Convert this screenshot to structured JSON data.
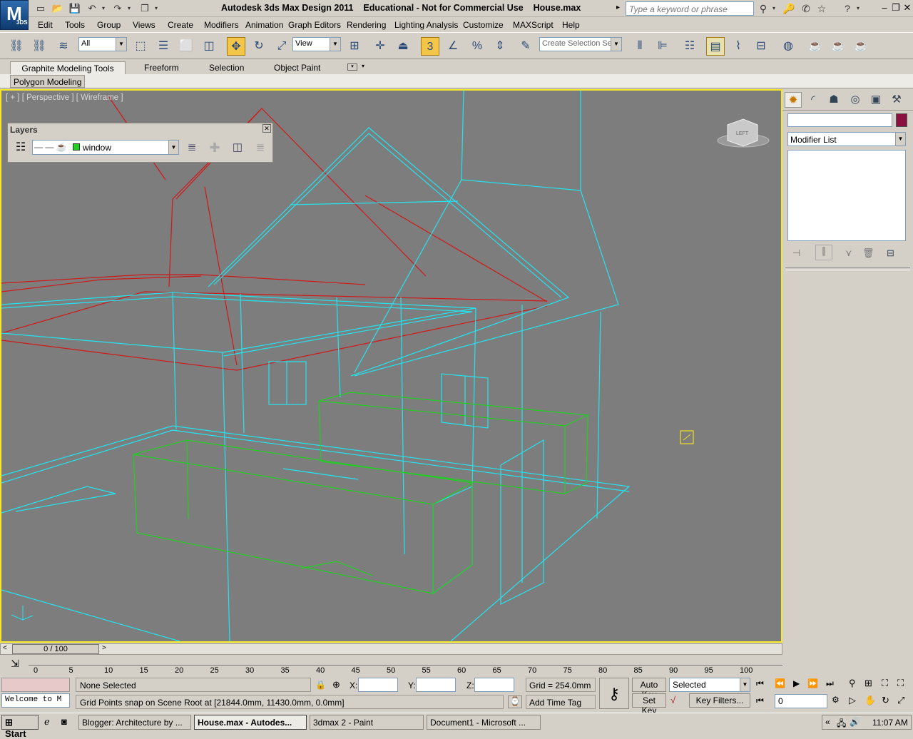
{
  "titlebar": {
    "logo": "3DS",
    "title": "Autodesk 3ds Max Design 2011    Educational - Not for Commercial Use    House.max",
    "search_placeholder": "Type a keyword or phrase"
  },
  "menu": [
    "Edit",
    "Tools",
    "Group",
    "Views",
    "Create",
    "Modifiers",
    "Animation",
    "Graph Editors",
    "Rendering",
    "Lighting Analysis",
    "Customize",
    "MAXScript",
    "Help"
  ],
  "toolbar": {
    "filter_value": "All",
    "coord_value": "View",
    "snap_label": "3",
    "selection_set_placeholder": "Create Selection Se"
  },
  "ribbon": {
    "tabs": [
      "Graphite Modeling Tools",
      "Freeform",
      "Selection",
      "Object Paint"
    ],
    "panel": "Polygon Modeling"
  },
  "viewport": {
    "label": "[ + ] [ Perspective ] [ Wireframe ]",
    "viewcube_label": "LEFT",
    "colors": {
      "background": "#7d7d7d",
      "border": "#f5e72e",
      "cyan": "#22e4f0",
      "red": "#d01818",
      "green": "#20d020",
      "yellow": "#f0e020"
    }
  },
  "layers": {
    "title": "Layers",
    "current_layer": "window",
    "layer_color": "#20d020"
  },
  "command_panel": {
    "modifier_list": "Modifier List",
    "swatch_color": "#8a1040"
  },
  "timeline": {
    "frame_display": "0 / 100",
    "ticks": [
      "0",
      "5",
      "10",
      "15",
      "20",
      "25",
      "30",
      "35",
      "40",
      "45",
      "50",
      "55",
      "60",
      "65",
      "70",
      "75",
      "80",
      "85",
      "90",
      "95",
      "100"
    ]
  },
  "status": {
    "maxscript_listener": "Welcome to M",
    "selection": "None Selected",
    "prompt": "Grid Points snap on Scene Root at [21844.0mm, 11430.0mm, 0.0mm]",
    "x_label": "X:",
    "y_label": "Y:",
    "z_label": "Z:",
    "grid": "Grid = 254.0mm",
    "add_time_tag": "Add Time Tag",
    "auto_key": "Auto Key",
    "set_key": "Set Key",
    "key_mode": "Selected",
    "key_filters": "Key Filters...",
    "current_frame": "0"
  },
  "taskbar": {
    "start": "Start",
    "tasks": [
      "Blogger: Architecture by ...",
      "House.max - Autodes...",
      "3dmax 2 - Paint",
      "Document1 - Microsoft ..."
    ],
    "clock": "11:07 AM"
  }
}
